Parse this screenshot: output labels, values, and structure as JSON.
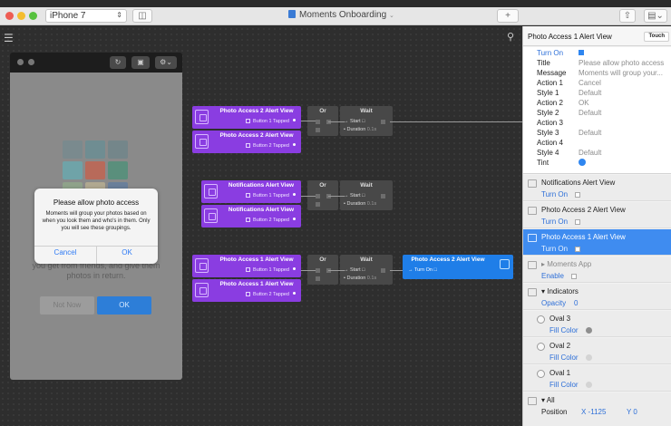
{
  "window": {
    "device": "iPhone 7",
    "document_title": "Moments Onboarding",
    "accent": "#3a7bd5"
  },
  "canvas": {
    "icons": [
      "hamburger-menu-icon",
      "search-icon"
    ]
  },
  "preview": {
    "alert": {
      "title": "Please allow photo access",
      "message": "Moments will group your photos based on when you look them and who's in them. Only you will see these groupings.",
      "cancel": "Cancel",
      "ok": "OK"
    },
    "background_text": [
      "you get from friends, and give them",
      "photos in return."
    ],
    "not_now": "Not Now",
    "ok_button": "OK"
  },
  "patch": {
    "groups": [
      {
        "inputs": [
          {
            "title": "Photo Access 2 Alert View",
            "port": "Button 1 Tapped"
          },
          {
            "title": "Photo Access 2 Alert View",
            "port": "Button 2 Tapped"
          }
        ],
        "or": "Or",
        "wait": {
          "title": "Wait",
          "start": "Start",
          "duration": "Duration",
          "duration_value": "0.1s"
        }
      },
      {
        "inputs": [
          {
            "title": "Notifications Alert View",
            "port": "Button 1 Tapped"
          },
          {
            "title": "Notifications Alert View",
            "port": "Button 2 Tapped"
          }
        ],
        "or": "Or",
        "wait": {
          "title": "Wait",
          "start": "Start",
          "duration": "Duration",
          "duration_value": "0.1s"
        }
      },
      {
        "inputs": [
          {
            "title": "Photo Access 1 Alert View",
            "port": "Button 1 Tapped"
          },
          {
            "title": "Photo Access 1 Alert View",
            "port": "Button 2 Tapped"
          }
        ],
        "or": "Or",
        "wait": {
          "title": "Wait",
          "start": "Start",
          "duration": "Duration",
          "duration_value": "0.1s"
        }
      }
    ],
    "output": {
      "title": "Photo Access 2 Alert View",
      "port": "Turn On"
    },
    "colors": {
      "purple": "#8a3de1",
      "logic": "#484848",
      "blue": "#1f7ee8"
    }
  },
  "inspector": {
    "title": "Photo Access 1 Alert View",
    "touch_label": "Touch",
    "properties": [
      {
        "label": "Turn On",
        "value": "",
        "blue": true
      },
      {
        "label": "Title",
        "value": "Please allow photo access"
      },
      {
        "label": "Message",
        "value": "Moments will group your..."
      },
      {
        "label": "Action 1",
        "value": "Cancel"
      },
      {
        "label": "Style 1",
        "value": "Default"
      },
      {
        "label": "Action 2",
        "value": "OK"
      },
      {
        "label": "Style 2",
        "value": "Default"
      },
      {
        "label": "Action 3",
        "value": ""
      },
      {
        "label": "Style 3",
        "value": "Default"
      },
      {
        "label": "Action 4",
        "value": ""
      },
      {
        "label": "Style 4",
        "value": "Default"
      },
      {
        "label": "Tint",
        "value": ""
      }
    ],
    "layers": [
      {
        "name": "Notifications Alert View",
        "sub": "Turn On"
      },
      {
        "name": "Photo Access 2 Alert View",
        "sub": "Turn On"
      },
      {
        "name": "Photo Access 1 Alert View",
        "sub": "Turn On",
        "selected": true
      },
      {
        "name": "▸ Moments App",
        "sub": "Enable"
      },
      {
        "name": "▾ Indicators",
        "sub": "Opacity",
        "sub_value": "0"
      },
      {
        "name": "Oval 3",
        "sub": "Fill Color",
        "fill": "#8f8f8f"
      },
      {
        "name": "Oval 2",
        "sub": "Fill Color",
        "fill": "#d4d4d4"
      },
      {
        "name": "Oval 1",
        "sub": "Fill Color",
        "fill": "#d4d4d4"
      },
      {
        "name": "▾ All",
        "sub": "Position",
        "pos_x": "X -1125",
        "pos_y": "Y 0"
      }
    ],
    "tint_color": "#2f86f0"
  }
}
